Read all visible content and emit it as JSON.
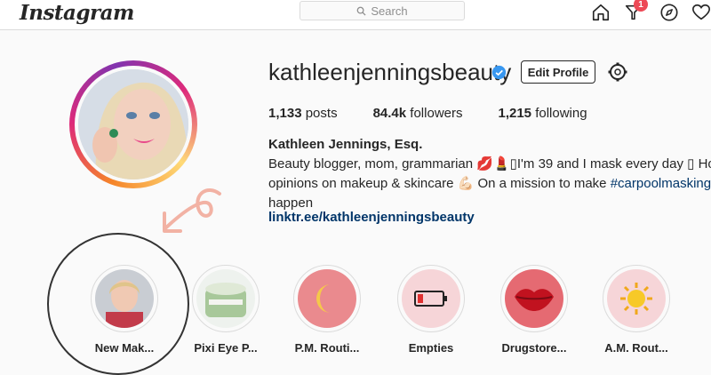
{
  "header": {
    "logo": "Instagram",
    "search_placeholder": "Search",
    "notification_count": "1",
    "icons": [
      "home-icon",
      "activity-icon",
      "explore-icon",
      "heart-icon"
    ]
  },
  "profile": {
    "username": "kathleenjenningsbeauty",
    "edit_label": "Edit Profile",
    "posts_count": "1,133",
    "posts_label": "posts",
    "followers_count": "84.4k",
    "followers_label": "followers",
    "following_count": "1,215",
    "following_label": "following",
    "full_name": "Kathleen Jennings, Esq.",
    "bio_line1": "Beauty blogger, mom, grammarian 💋💄▯I'm 39 and I mask every day ▯ Honest",
    "bio_line2_pre": "opinions on makeup & skincare 💪🏻 On a mission to make ",
    "bio_hashtag": "#carpoolmasking",
    "bio_line3": "happen",
    "link": "linktr.ee/kathleenjenningsbeauty"
  },
  "highlights": [
    {
      "label": "New Mak..."
    },
    {
      "label": "Pixi Eye P..."
    },
    {
      "label": "P.M. Routi..."
    },
    {
      "label": "Empties"
    },
    {
      "label": "Drugstore..."
    },
    {
      "label": "A.M. Rout..."
    }
  ],
  "colors": {
    "accent_link": "#003569",
    "verified_blue": "#3897f0",
    "badge_red": "#ed4956"
  }
}
